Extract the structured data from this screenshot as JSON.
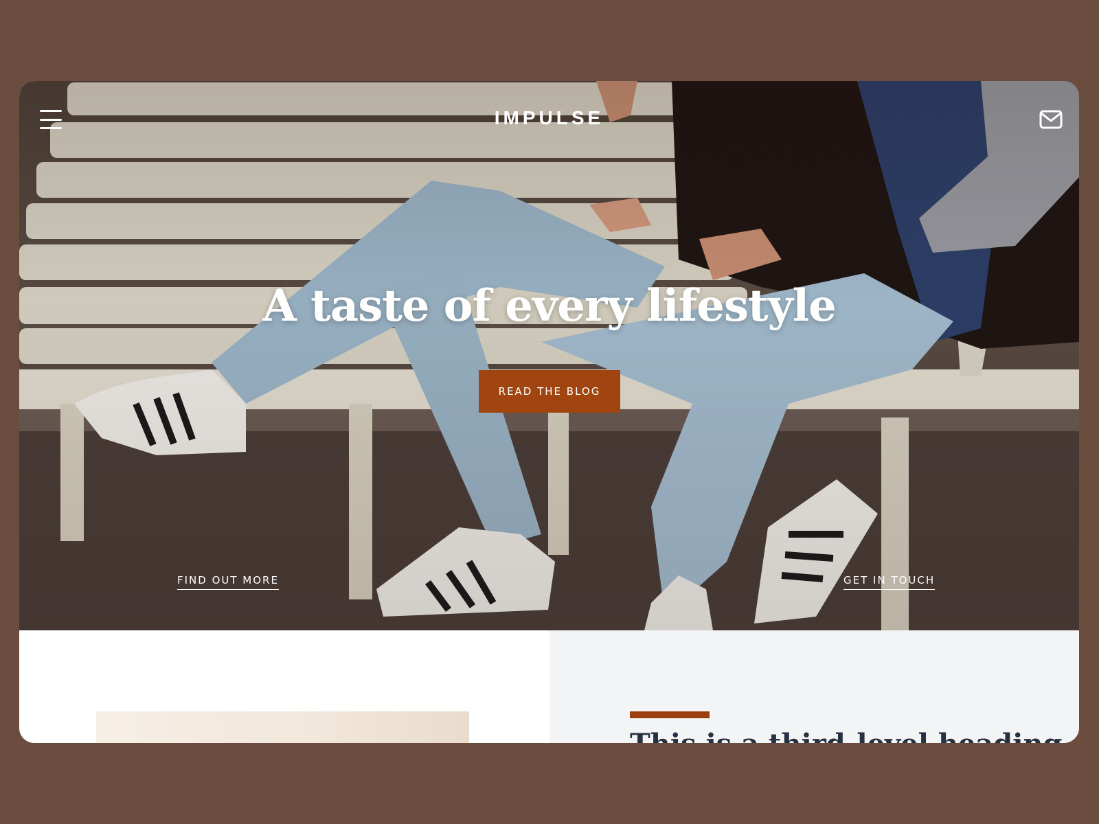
{
  "app": {
    "brand": "IMPULSE",
    "accent_color": "#a0450f",
    "background_color": "#6b4d40"
  },
  "header": {
    "menu_icon": "hamburger-menu-icon",
    "mail_icon": "envelope-icon"
  },
  "hero": {
    "headline": "A taste of every lifestyle",
    "cta_label": "READ THE BLOG",
    "link_left": "FIND OUT MORE",
    "link_right": "GET IN TOUCH",
    "image": "photo-two-people-jeans-sneakers-on-bench"
  },
  "section": {
    "title": "This is a third-level heading",
    "accent_bar_color": "#9b3f0e"
  }
}
